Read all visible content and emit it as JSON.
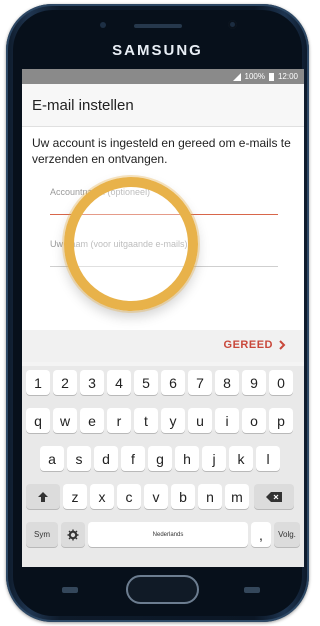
{
  "device": {
    "brand": "SAMSUNG"
  },
  "statusbar": {
    "battery": "100%",
    "time": "12:00"
  },
  "app": {
    "title": "E-mail instellen",
    "description": "Uw account is ingesteld en gereed om e-mails te verzenden en ontvangen.",
    "fields": [
      {
        "placeholder": "Accountnaam (optioneel)"
      },
      {
        "placeholder": "Uw naam (voor uitgaande e-mails)"
      }
    ],
    "done_label": "GEREED",
    "done_icon": "chevron-right-icon",
    "accent_color": "#c9483b"
  },
  "keyboard": {
    "number_row": [
      "1",
      "2",
      "3",
      "4",
      "5",
      "6",
      "7",
      "8",
      "9",
      "0"
    ],
    "row1": [
      "q",
      "w",
      "e",
      "r",
      "t",
      "y",
      "u",
      "i",
      "o",
      "p"
    ],
    "row2": [
      "a",
      "s",
      "d",
      "f",
      "g",
      "h",
      "j",
      "k",
      "l"
    ],
    "row3": [
      "z",
      "x",
      "c",
      "v",
      "b",
      "n",
      "m"
    ],
    "shift_icon": "shift-arrow-icon",
    "backspace_icon": "backspace-icon",
    "sym_label": "Sym",
    "settings_icon": "gear-icon",
    "space_label": "Nederlands",
    "comma_label": ",",
    "next_label": "Volg."
  }
}
